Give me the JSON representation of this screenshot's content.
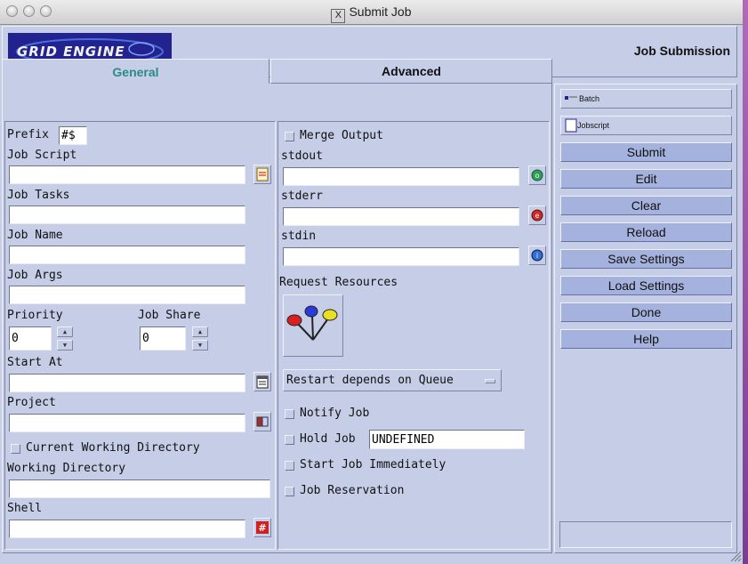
{
  "window": {
    "title": "Submit Job"
  },
  "header": {
    "logo_text": "GRID ENGINE",
    "heading": "Job Submission"
  },
  "tabs": {
    "general": "General",
    "advanced": "Advanced",
    "active": "general"
  },
  "left": {
    "prefix_label": "Prefix",
    "prefix_value": "#$",
    "job_script_label": "Job Script",
    "job_tasks_label": "Job Tasks",
    "job_name_label": "Job Name",
    "job_args_label": "Job Args",
    "priority_label": "Priority",
    "priority_value": "0",
    "job_share_label": "Job Share",
    "job_share_value": "0",
    "start_at_label": "Start At",
    "project_label": "Project",
    "cwd_label": "Current Working Directory",
    "working_dir_label": "Working Directory",
    "shell_label": "Shell"
  },
  "middle": {
    "merge_output_label": "Merge Output",
    "stdout_label": "stdout",
    "stderr_label": "stderr",
    "stdin_label": "stdin",
    "request_resources_label": "Request Resources",
    "restart_option": "Restart depends on Queue",
    "notify_job_label": "Notify Job",
    "hold_job_label": "Hold Job",
    "hold_job_value": "UNDEFINED",
    "start_immediately_label": "Start Job Immediately",
    "job_reservation_label": "Job Reservation"
  },
  "right": {
    "batch_label": "Batch",
    "jobscript_label": "Jobscript",
    "buttons": [
      "Submit",
      "Edit",
      "Clear",
      "Reload",
      "Save Settings",
      "Load Settings",
      "Done",
      "Help"
    ]
  },
  "colors": {
    "active_tab": "#2a8a86",
    "panel": "#c6cde6",
    "button": "#a4b2dd",
    "logo_bg": "#23238f"
  }
}
